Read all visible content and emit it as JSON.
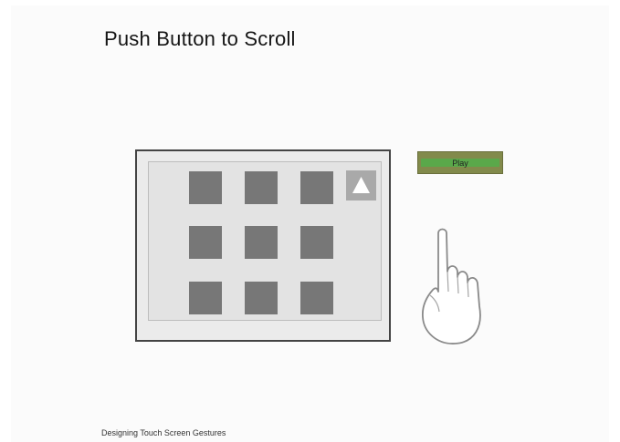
{
  "title": "Push Button to Scroll",
  "play_button": {
    "label": "Play"
  },
  "scroll_button": {
    "icon": "triangle-up-icon"
  },
  "grid": {
    "rows": 3,
    "cols": 3
  },
  "footer": "Designing Touch Screen Gestures",
  "colors": {
    "background": "#fbfbfb",
    "tile": "#777777",
    "play_button": "#828a4b",
    "play_stripe": "#5aa84a"
  }
}
